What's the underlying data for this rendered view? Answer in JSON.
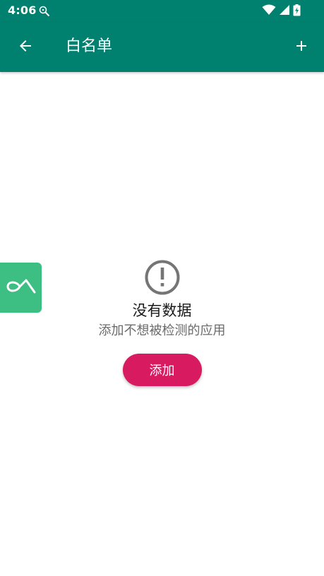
{
  "status_bar": {
    "time": "4:06",
    "left_icon": "accessibility-search-icon",
    "right_icons": [
      "wifi-icon",
      "signal-icon",
      "battery-icon"
    ]
  },
  "app_bar": {
    "title": "白名单",
    "back_icon": "arrow-back-icon",
    "add_icon": "plus-icon",
    "background_color": "#00806E"
  },
  "floating_widget": {
    "icon": "loop-logo-icon",
    "color": "#3DBE83"
  },
  "empty_state": {
    "icon": "alert-circle-icon",
    "title": "没有数据",
    "subtitle": "添加不想被检测的应用",
    "button_label": "添加",
    "button_color": "#D81B60"
  }
}
